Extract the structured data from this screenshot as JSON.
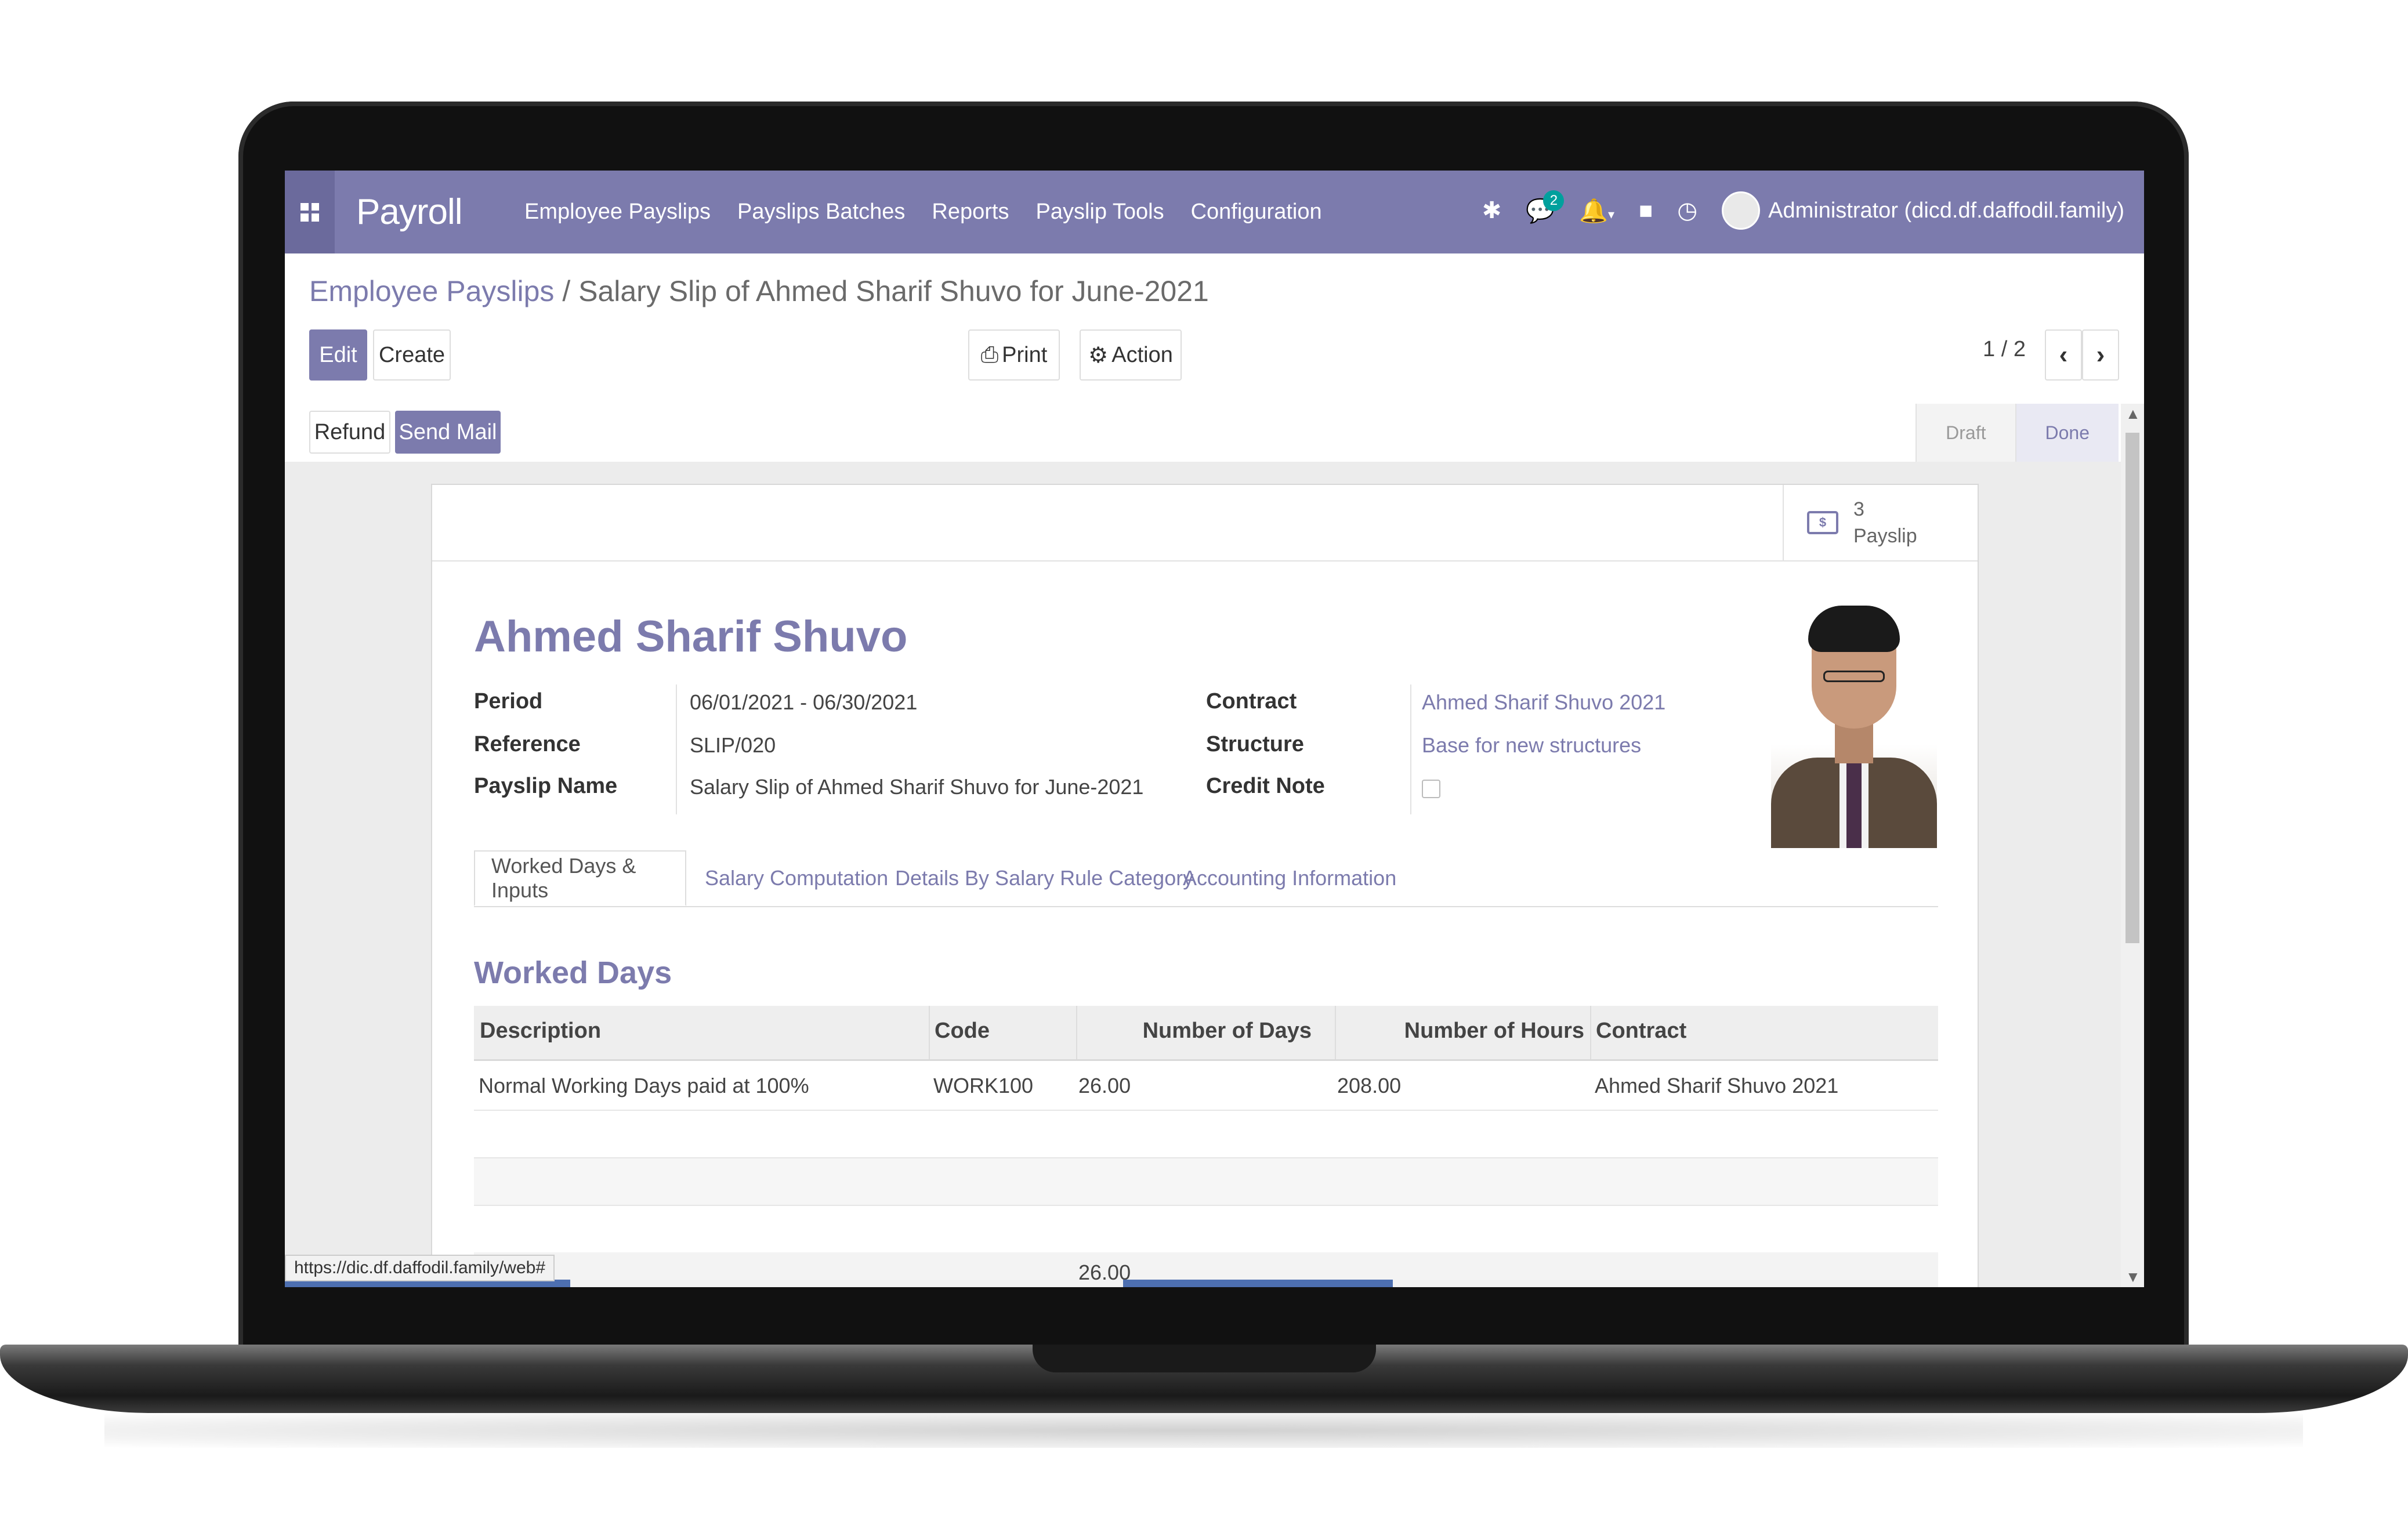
{
  "app": {
    "name": "Payroll",
    "menu": [
      "Employee Payslips",
      "Payslips Batches",
      "Reports",
      "Payslip Tools",
      "Configuration"
    ],
    "user": "Administrator (dicd.df.daffodil.family)",
    "chat_badge": "2"
  },
  "control": {
    "breadcrumb_parent": "Employee Payslips",
    "breadcrumb_sep": " / ",
    "breadcrumb_current": "Salary Slip of Ahmed Sharif Shuvo for June-2021",
    "edit": "Edit",
    "create": "Create",
    "print": "Print",
    "action": "Action",
    "pager": "1 / 2"
  },
  "statusbar": {
    "refund": "Refund",
    "send_mail": "Send Mail",
    "steps": [
      "Draft",
      "Done"
    ]
  },
  "stat": {
    "count": "3",
    "label": "Payslip"
  },
  "employee": {
    "name": "Ahmed Sharif Shuvo",
    "period_label": "Period",
    "period": "06/01/2021 - 06/30/2021",
    "reference_label": "Reference",
    "reference": "SLIP/020",
    "payslip_name_label": "Payslip Name",
    "payslip_name": "Salary Slip of Ahmed Sharif Shuvo for June-2021",
    "contract_label": "Contract",
    "contract": "Ahmed Sharif Shuvo 2021",
    "structure_label": "Structure",
    "structure": "Base for new structures",
    "credit_note_label": "Credit Note"
  },
  "tabs": [
    "Worked Days & Inputs",
    "Salary Computation",
    "Details By Salary Rule Category",
    "Accounting Information"
  ],
  "worked_days": {
    "title": "Worked Days",
    "headers": [
      "Description",
      "Code",
      "Number of Days",
      "Number of Hours",
      "Contract"
    ],
    "rows": [
      [
        "Normal Working Days paid at 100%",
        "WORK100",
        "26.00",
        "208.00",
        "Ahmed Sharif Shuvo 2021"
      ]
    ],
    "total_days": "26.00"
  },
  "status_url": "https://dic.df.daffodil.family/web#"
}
